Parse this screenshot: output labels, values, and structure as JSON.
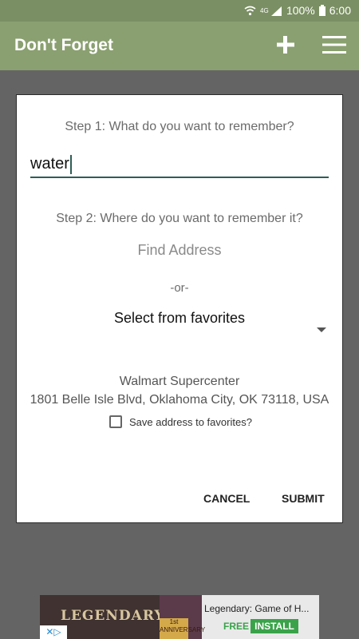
{
  "status_bar": {
    "battery_percent": "100%",
    "time": "6:00",
    "icons": [
      "wifi-icon",
      "4g-signal-icon",
      "battery-icon"
    ]
  },
  "app_bar": {
    "title": "Don't Forget",
    "actions": [
      "add-icon",
      "menu-icon"
    ]
  },
  "dialog": {
    "step1_label": "Step 1: What do you want to remember?",
    "memo_value": "water",
    "step2_label": "Step 2: Where do you want to remember it?",
    "find_address": "Find Address",
    "or_text": "-or-",
    "favorites_selected": "Select from favorites",
    "place_name": "Walmart Supercenter",
    "place_address": "1801 Belle Isle Blvd, Oklahoma City, OK 73118, USA",
    "save_favorite_label": "Save address to favorites?",
    "save_favorite_checked": false,
    "cancel_label": "CANCEL",
    "submit_label": "SUBMIT"
  },
  "ad": {
    "logo_text": "LEGENDARY",
    "badge_text": "1st ANNIVERSARY",
    "title": "Legendary: Game of H...",
    "free_label": "FREE",
    "install_label": "INSTALL"
  },
  "colors": {
    "status_bar": "#7a8f63",
    "app_bar": "#8aa070",
    "accent": "#2e5e55",
    "ad_green": "#3aa34a"
  }
}
